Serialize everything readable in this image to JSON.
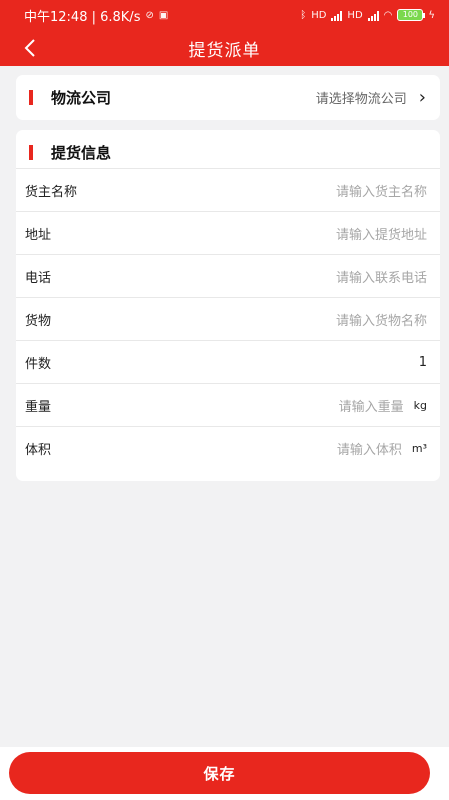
{
  "status_bar": {
    "left_text": "中午12:48 | 6.8K/s",
    "mute_icon": "mute-icon",
    "notification_icon": "notification-icon",
    "signal_1": "HD",
    "signal_2": "HD",
    "battery": "100",
    "charging_icon": "charging-icon"
  },
  "header": {
    "title": "提货派单",
    "back_icon": "back-icon"
  },
  "logistics": {
    "label": "物流公司",
    "placeholder": "请选择物流公司",
    "chevron_icon": "chevron-right-icon"
  },
  "pickup_info": {
    "section_title": "提货信息",
    "rows": [
      {
        "label": "货主名称",
        "placeholder": "请输入货主名称"
      },
      {
        "label": "地址",
        "placeholder": "请输入提货地址"
      },
      {
        "label": "电话",
        "placeholder": "请输入联系电话"
      },
      {
        "label": "货物",
        "placeholder": "请输入货物名称"
      },
      {
        "label": "件数",
        "value": "1"
      },
      {
        "label": "重量",
        "placeholder": "请输入重量",
        "unit": "kg"
      },
      {
        "label": "体积",
        "placeholder": "请输入体积",
        "unit": "m³"
      }
    ]
  },
  "footer": {
    "save_label": "保存"
  },
  "colors": {
    "accent": "#e8271e",
    "background": "#f2f2f3",
    "placeholder": "#a6a6a6"
  }
}
